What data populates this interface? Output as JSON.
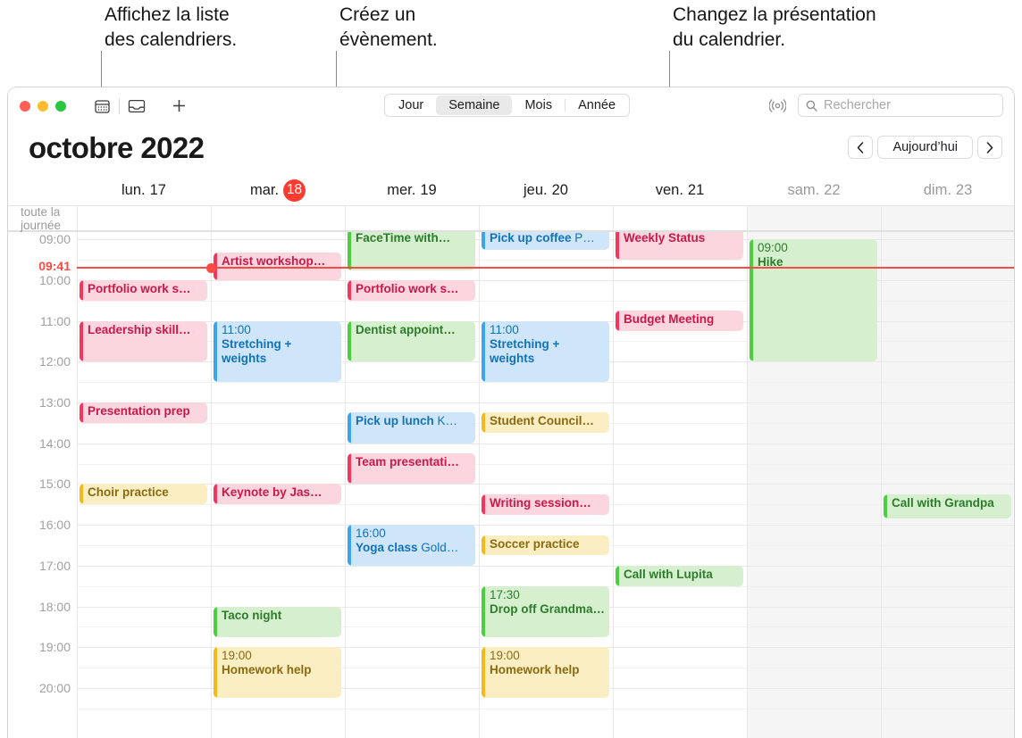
{
  "callouts": [
    {
      "text": "Affichez la liste\ndes calendriers."
    },
    {
      "text": "Créez un\névènement."
    },
    {
      "text": "Changez la présentation\ndu calendrier."
    }
  ],
  "toolbar": {
    "calendar_list_icon": "calendar-icon",
    "inbox_icon": "inbox-icon",
    "add_icon": "+",
    "views": [
      {
        "label": "Jour",
        "selected": false
      },
      {
        "label": "Semaine",
        "selected": true
      },
      {
        "label": "Mois",
        "selected": false
      },
      {
        "label": "Année",
        "selected": false
      }
    ],
    "radar_icon": "radar-icon",
    "search_placeholder": "Rechercher",
    "search_value": ""
  },
  "header": {
    "month_title": "octobre 2022",
    "prev_label": "‹",
    "today_label": "Aujourd’hui",
    "next_label": "›"
  },
  "allday_label": "toute la journée",
  "days": [
    {
      "name": "lun.",
      "num": "17",
      "today": false,
      "weekend": false
    },
    {
      "name": "mar.",
      "num": "18",
      "today": true,
      "weekend": false
    },
    {
      "name": "mer.",
      "num": "19",
      "today": false,
      "weekend": false
    },
    {
      "name": "jeu.",
      "num": "20",
      "today": false,
      "weekend": false
    },
    {
      "name": "ven.",
      "num": "21",
      "today": false,
      "weekend": false
    },
    {
      "name": "sam.",
      "num": "22",
      "today": false,
      "weekend": true
    },
    {
      "name": "dim.",
      "num": "23",
      "today": false,
      "weekend": true
    }
  ],
  "hours": [
    "09:00",
    "10:00",
    "11:00",
    "12:00",
    "13:00",
    "14:00",
    "15:00",
    "16:00",
    "17:00",
    "18:00",
    "19:00",
    "20:00"
  ],
  "now": {
    "label": "09:41",
    "day_index": 1
  },
  "colors": {
    "red": "#f4365f",
    "green": "#4ccf3e",
    "blue": "#3ba4ef",
    "yellow": "#f5b91c",
    "today_badge": "#ff3b30",
    "now_line": "#fa4b42"
  },
  "events": [
    {
      "day": 0,
      "start": "10:00",
      "end": "10:30",
      "title": "Portfolio work s…",
      "time": "",
      "loc": "",
      "color": "red"
    },
    {
      "day": 0,
      "start": "11:00",
      "end": "12:00",
      "title": "Leadership skill…",
      "time": "",
      "loc": "",
      "color": "red"
    },
    {
      "day": 0,
      "start": "13:00",
      "end": "13:30",
      "title": "Presentation prep",
      "time": "",
      "loc": "",
      "color": "red"
    },
    {
      "day": 0,
      "start": "15:00",
      "end": "15:30",
      "title": "Choir practice",
      "time": "",
      "loc": "",
      "color": "yellow"
    },
    {
      "day": 1,
      "start": "09:20",
      "end": "10:00",
      "title": "Artist workshop…",
      "time": "",
      "loc": "",
      "color": "red"
    },
    {
      "day": 1,
      "start": "11:00",
      "end": "12:30",
      "title": "Stretching + weights",
      "time": "11:00",
      "loc": "",
      "color": "blue"
    },
    {
      "day": 1,
      "start": "15:00",
      "end": "15:30",
      "title": "Keynote by Jas…",
      "time": "",
      "loc": "",
      "color": "red"
    },
    {
      "day": 1,
      "start": "18:00",
      "end": "18:45",
      "title": "Taco night",
      "time": "",
      "loc": "",
      "color": "green"
    },
    {
      "day": 1,
      "start": "19:00",
      "end": "20:15",
      "title": "Homework help",
      "time": "19:00",
      "loc": "",
      "color": "yellow"
    },
    {
      "day": 2,
      "start": "08:45",
      "end": "09:45",
      "title": "FaceTime with…",
      "time": "",
      "loc": "",
      "color": "green"
    },
    {
      "day": 2,
      "start": "10:00",
      "end": "10:30",
      "title": "Portfolio work s…",
      "time": "",
      "loc": "",
      "color": "red"
    },
    {
      "day": 2,
      "start": "11:00",
      "end": "12:00",
      "title": "Dentist appoint…",
      "time": "",
      "loc": "",
      "color": "green"
    },
    {
      "day": 2,
      "start": "13:15",
      "end": "14:00",
      "title": "Pick up lunch",
      "time": "",
      "loc": "K…",
      "color": "blue"
    },
    {
      "day": 2,
      "start": "14:15",
      "end": "15:00",
      "title": "Team presentati…",
      "time": "",
      "loc": "",
      "color": "red"
    },
    {
      "day": 2,
      "start": "16:00",
      "end": "17:00",
      "title": "Yoga class",
      "time": "16:00",
      "loc": "Gold…",
      "color": "blue"
    },
    {
      "day": 3,
      "start": "08:45",
      "end": "09:15",
      "title": "Pick up coffee",
      "time": "",
      "loc": "P…",
      "color": "blue"
    },
    {
      "day": 3,
      "start": "11:00",
      "end": "12:30",
      "title": "Stretching + weights",
      "time": "11:00",
      "loc": "",
      "color": "blue"
    },
    {
      "day": 3,
      "start": "13:15",
      "end": "13:45",
      "title": "Student Council…",
      "time": "",
      "loc": "",
      "color": "yellow"
    },
    {
      "day": 3,
      "start": "15:15",
      "end": "15:45",
      "title": "Writing session…",
      "time": "",
      "loc": "",
      "color": "red"
    },
    {
      "day": 3,
      "start": "16:15",
      "end": "16:45",
      "title": "Soccer practice",
      "time": "",
      "loc": "",
      "color": "yellow"
    },
    {
      "day": 3,
      "start": "17:30",
      "end": "18:45",
      "title": "Drop off Grandma…",
      "time": "17:30",
      "loc": "",
      "color": "green"
    },
    {
      "day": 3,
      "start": "19:00",
      "end": "20:15",
      "title": "Homework help",
      "time": "19:00",
      "loc": "",
      "color": "yellow"
    },
    {
      "day": 4,
      "start": "08:45",
      "end": "09:30",
      "title": "Weekly Status",
      "time": "",
      "loc": "",
      "color": "red"
    },
    {
      "day": 4,
      "start": "10:45",
      "end": "11:15",
      "title": "Budget Meeting",
      "time": "",
      "loc": "",
      "color": "red"
    },
    {
      "day": 4,
      "start": "17:00",
      "end": "17:30",
      "title": "Call with Lupita",
      "time": "",
      "loc": "",
      "color": "green"
    },
    {
      "day": 5,
      "start": "09:00",
      "end": "12:00",
      "title": "Hike",
      "time": "09:00",
      "loc": "",
      "color": "green"
    },
    {
      "day": 6,
      "start": "15:15",
      "end": "15:50",
      "title": "Call with Grandpa",
      "time": "",
      "loc": "",
      "color": "green"
    }
  ]
}
